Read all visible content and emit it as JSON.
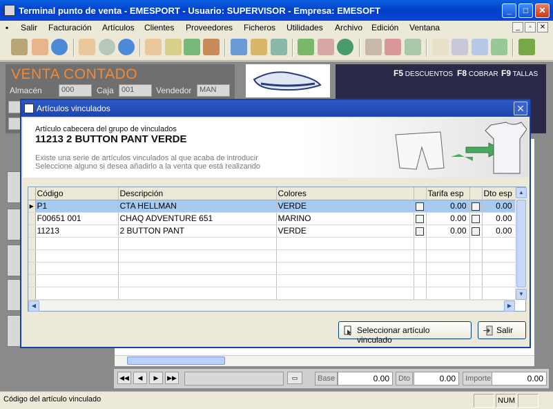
{
  "window": {
    "title": "Terminal punto de venta - EMESPORT  -  Usuario: SUPERVISOR  -  Empresa: EMESOFT"
  },
  "menu": {
    "items": [
      "Salir",
      "Facturación",
      "Artículos",
      "Clientes",
      "Proveedores",
      "Ficheros",
      "Utilidades",
      "Archivo",
      "Edición",
      "Ventana"
    ]
  },
  "background": {
    "venta_title": "VENTA CONTADO",
    "almacen_label": "Almacén",
    "almacen_value": "000",
    "caja_label": "Caja",
    "caja_value": "001",
    "vendedor_label": "Vendedor",
    "vendedor_value": "MAN",
    "f5": "F5",
    "f5_label": "DESCUENTOS",
    "f8": "F8",
    "f8_label": "COBRAR",
    "f9": "F9",
    "f9_label": "TALLAS",
    "base_label": "Base",
    "base_value": "0.00",
    "dto_label": "Dto",
    "dto_value": "0.00",
    "importe_label": "Importe",
    "importe_value": "0.00"
  },
  "dialog": {
    "title": "Artículos vinculados",
    "header_caption": "Artículo cabecera del grupo de vinculados",
    "header_article": "11213 2 BUTTON PANT VERDE",
    "message_line1": "Existe una serie de artículos vinculados al que acaba de introducir",
    "message_line2": "Seleccione alguno si desea añadirlo a la venta que está realizando",
    "columns": {
      "codigo": "Código",
      "descripcion": "Descripción",
      "colores": "Colores",
      "tarifa": "Tarifa esp",
      "dto": "Dto esp"
    },
    "rows": [
      {
        "codigo": "P1",
        "descripcion": "CTA HELLMAN",
        "colores": "VERDE",
        "tarifa": "0.00",
        "dto": "0.00"
      },
      {
        "codigo": "F00651 001",
        "descripcion": "CHAQ  ADVENTURE 651",
        "colores": "MARINO",
        "tarifa": "0.00",
        "dto": "0.00"
      },
      {
        "codigo": "11213",
        "descripcion": "2 BUTTON PANT",
        "colores": "VERDE",
        "tarifa": "0.00",
        "dto": "0.00"
      }
    ],
    "select_button": "Seleccionar artículo vinculado",
    "exit_button": "Salir"
  },
  "status": {
    "text": "Código del artículo vinculado",
    "num": "NUM"
  },
  "colors": {
    "titlebar": "#0040c8",
    "dialog_title": "#1e45b0",
    "selected_row": "#a6caf0",
    "venta_title": "#f08a3a"
  }
}
